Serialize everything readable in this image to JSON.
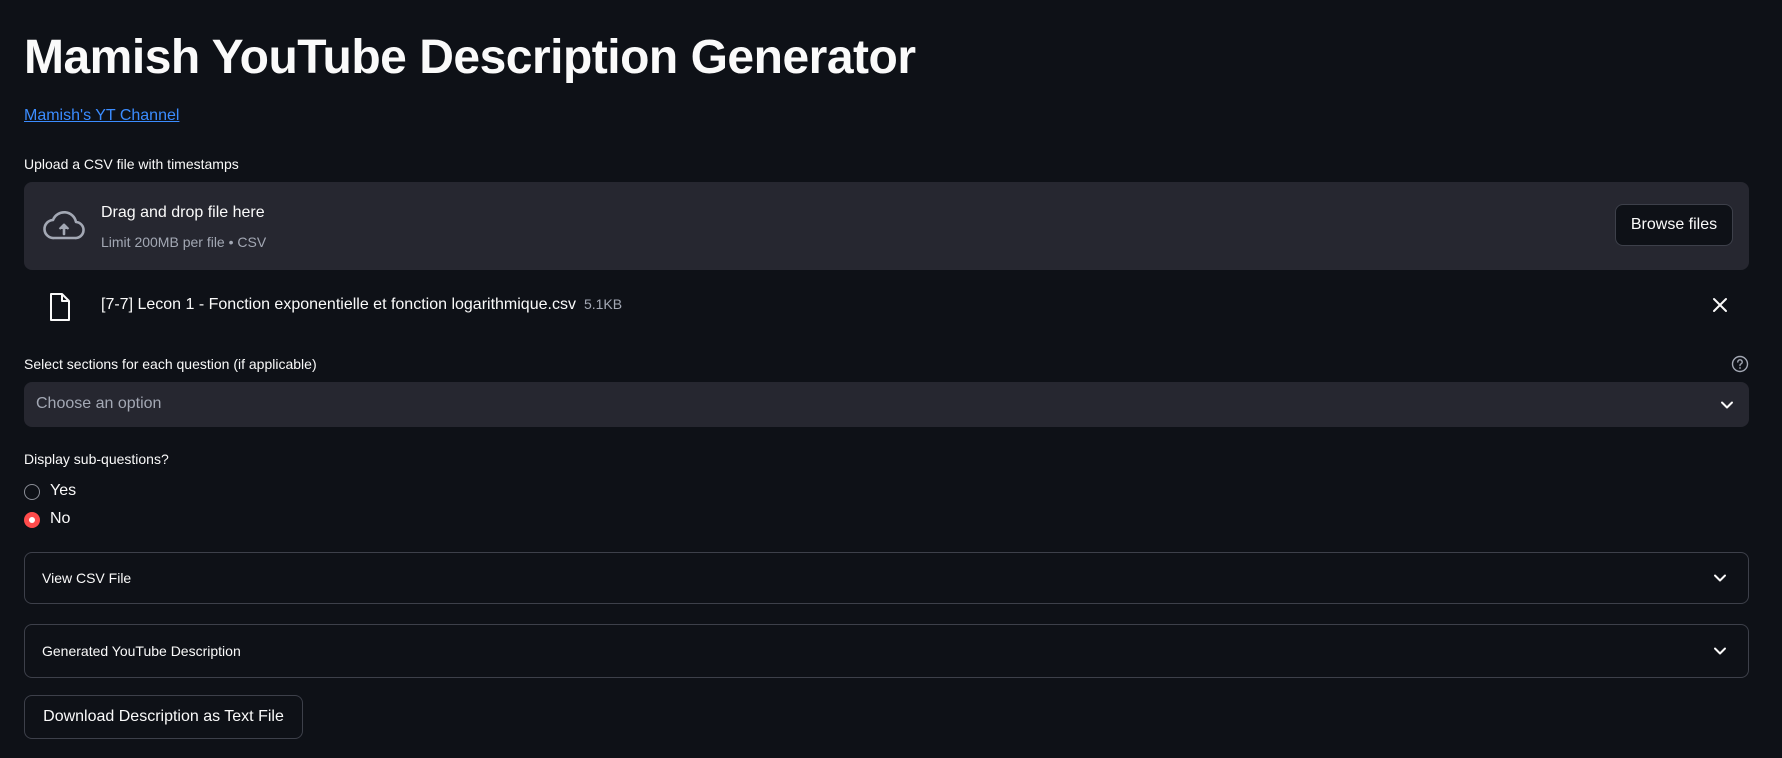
{
  "app": {
    "title": "Mamish YouTube Description Generator",
    "channel_link": "Mamish's YT Channel"
  },
  "uploader": {
    "label": "Upload a CSV file with timestamps",
    "drop_text": "Drag and drop file here",
    "limit_text": "Limit 200MB per file • CSV",
    "browse_label": "Browse files",
    "icon": "cloud-upload-icon"
  },
  "uploaded_file": {
    "name": "[7-7] Lecon 1 - Fonction exponentielle et fonction logarithmique.csv",
    "size": "5.1KB",
    "icon": "file-icon"
  },
  "sections_select": {
    "label": "Select sections for each question (if applicable)",
    "placeholder": "Choose an option"
  },
  "subquestions": {
    "label": "Display sub-questions?",
    "options": [
      {
        "label": "Yes",
        "selected": false
      },
      {
        "label": "No",
        "selected": true
      }
    ]
  },
  "expanders": [
    {
      "label": "View CSV File"
    },
    {
      "label": "Generated YouTube Description"
    }
  ],
  "download": {
    "label": "Download Description as Text File"
  },
  "colors": {
    "background": "#0e1117",
    "surface": "#262730",
    "accent": "#ff4b4b",
    "link": "#3b8cff"
  }
}
